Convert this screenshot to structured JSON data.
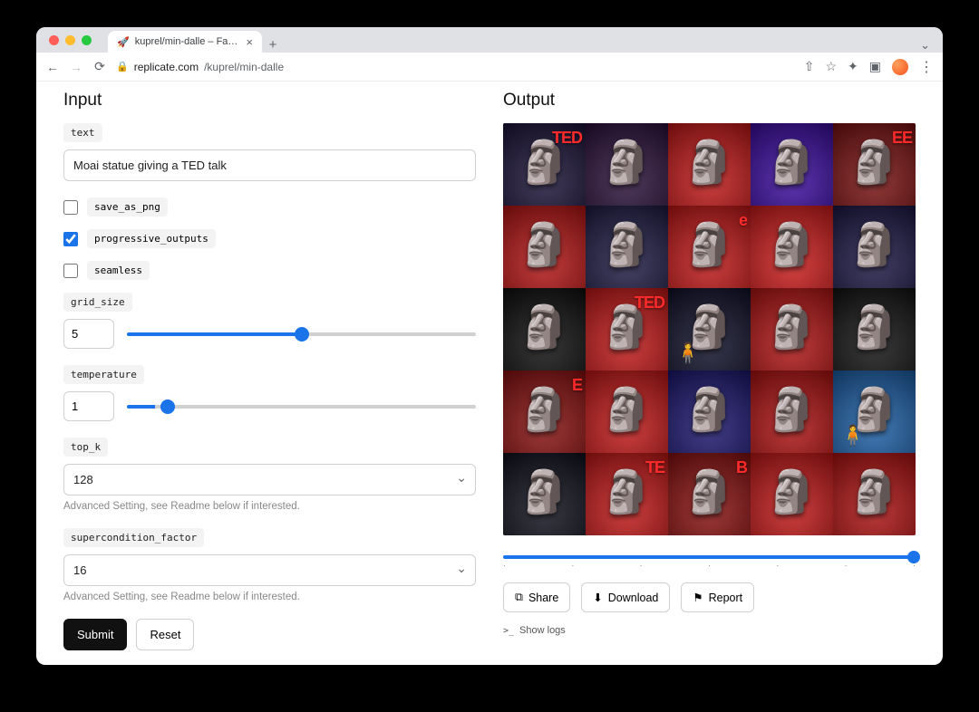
{
  "browser": {
    "tab_title": "kuprel/min-dalle – Fast, minim…",
    "tab_favicon": "🚀",
    "url_domain": "replicate.com",
    "url_path": "/kuprel/min-dalle"
  },
  "page": {
    "input_heading": "Input",
    "output_heading": "Output"
  },
  "form": {
    "text": {
      "label": "text",
      "value": "Moai statue giving a TED talk"
    },
    "save_as_png": {
      "label": "save_as_png",
      "checked": false
    },
    "progressive_outputs": {
      "label": "progressive_outputs",
      "checked": true
    },
    "seamless": {
      "label": "seamless",
      "checked": false
    },
    "grid_size": {
      "label": "grid_size",
      "value": "5"
    },
    "temperature": {
      "label": "temperature",
      "value": "1"
    },
    "top_k": {
      "label": "top_k",
      "value": "128",
      "hint": "Advanced Setting, see Readme below if interested."
    },
    "supercondition_factor": {
      "label": "supercondition_factor",
      "value": "16",
      "hint": "Advanced Setting, see Readme below if interested."
    },
    "submit_label": "Submit",
    "reset_label": "Reset"
  },
  "output": {
    "share_label": "Share",
    "download_label": "Download",
    "report_label": "Report",
    "show_logs_label": "Show logs",
    "grid_cells": [
      {
        "bg": "#1a1238",
        "ted": "TED"
      },
      {
        "bg": "#2a0f3a",
        "ted": ""
      },
      {
        "bg": "#c41616",
        "ted": ""
      },
      {
        "bg": "#3a0aa0",
        "ted": ""
      },
      {
        "bg": "#7a0f0f",
        "ted": "EE"
      },
      {
        "bg": "#b71313",
        "ted": ""
      },
      {
        "bg": "#1e1a44",
        "ted": ""
      },
      {
        "bg": "#c41616",
        "ted": "e"
      },
      {
        "bg": "#d01a1a",
        "ted": ""
      },
      {
        "bg": "#1b1644",
        "ted": ""
      },
      {
        "bg": "#0d0d0d",
        "ted": ""
      },
      {
        "bg": "#c41616",
        "ted": "TED"
      },
      {
        "bg": "#0e0e28",
        "ted": ""
      },
      {
        "bg": "#b31212",
        "ted": ""
      },
      {
        "bg": "#111",
        "ted": ""
      },
      {
        "bg": "#8a0e0e",
        "ted": "E"
      },
      {
        "bg": "#c41616",
        "ted": ""
      },
      {
        "bg": "#1a1570",
        "ted": ""
      },
      {
        "bg": "#b01010",
        "ted": ""
      },
      {
        "bg": "#1b5fa8",
        "ted": ""
      },
      {
        "bg": "#0f0f1c",
        "ted": ""
      },
      {
        "bg": "#c41616",
        "ted": "TE"
      },
      {
        "bg": "#8a0e0e",
        "ted": "B"
      },
      {
        "bg": "#c41616",
        "ted": ""
      },
      {
        "bg": "#b01010",
        "ted": ""
      }
    ]
  }
}
